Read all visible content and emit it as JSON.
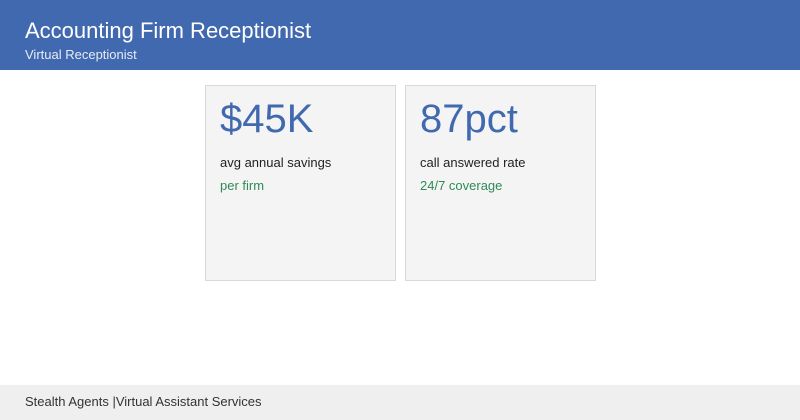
{
  "header": {
    "title": "Accounting Firm Receptionist",
    "subtitle": "Virtual Receptionist"
  },
  "stats": [
    {
      "value": "$45K",
      "label": "avg annual savings",
      "note": "per firm"
    },
    {
      "value": "87pct",
      "label": "call answered rate",
      "note": "24/7 coverage"
    }
  ],
  "footer": {
    "text": "Stealth Agents |Virtual Assistant Services"
  },
  "colors": {
    "header_bg": "#4169af",
    "accent": "#4169af",
    "note": "#2e8b57",
    "card_bg": "#f4f4f4",
    "footer_bg": "#efefef"
  }
}
